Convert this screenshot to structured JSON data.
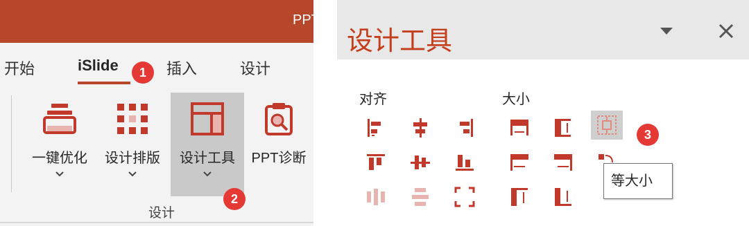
{
  "ribbon": {
    "title": "PPT",
    "tabs": [
      {
        "label": "开始"
      },
      {
        "label": "iSlide"
      },
      {
        "label": "插入"
      },
      {
        "label": "设计"
      }
    ],
    "buttons": [
      {
        "label": "一键优化",
        "icon": "stack-icon"
      },
      {
        "label": "设计排版",
        "icon": "grid-icon"
      },
      {
        "label": "设计工具",
        "icon": "layout-icon"
      },
      {
        "label": "PPT诊断",
        "icon": "clipboard-search-icon"
      }
    ],
    "group_label": "设计"
  },
  "pane": {
    "title": "设计工具",
    "align_label": "对齐",
    "size_label": "大小",
    "tooltip": "等大小"
  },
  "badges": {
    "b1": "1",
    "b2": "2",
    "b3": "3"
  },
  "colors": {
    "accent": "#b7472a",
    "icon_red": "#c0392b",
    "icon_faded": "#e8b4b0",
    "badge": "#e53935"
  }
}
